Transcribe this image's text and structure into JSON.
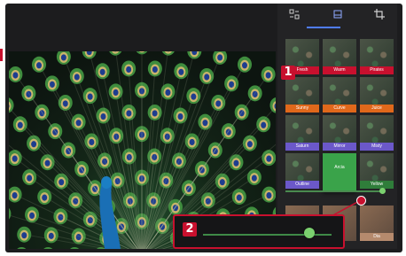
{
  "toolbar": {
    "tabs": [
      {
        "icon": "adjust-icon"
      },
      {
        "icon": "filters-icon",
        "selected": true
      },
      {
        "icon": "crop-icon"
      }
    ]
  },
  "filters": [
    {
      "label": "Fresh",
      "color": "#c8102e"
    },
    {
      "label": "Warm",
      "color": "#c8102e"
    },
    {
      "label": "Pirates",
      "color": "#c8102e"
    },
    {
      "label": "Sunny",
      "color": "#e0681b"
    },
    {
      "label": "Curve",
      "color": "#e0681b"
    },
    {
      "label": "Juice",
      "color": "#e0681b"
    },
    {
      "label": "Saturn",
      "color": "#6b58c9"
    },
    {
      "label": "Mirror",
      "color": "#6b58c9"
    },
    {
      "label": "Misty",
      "color": "#6b58c9"
    },
    {
      "label": "Outline",
      "color": "#6b58c9"
    },
    {
      "label": "Arcia",
      "color": "#3aa34a",
      "selected": true
    },
    {
      "label": "Yellow",
      "color": "#2f7d3a"
    }
  ],
  "bottom_row": [
    {
      "label": ""
    },
    {
      "label": ""
    },
    {
      "label": "Dia"
    }
  ],
  "callouts": {
    "one": "1",
    "two": "2"
  },
  "intensity": {
    "value": 0.83
  }
}
